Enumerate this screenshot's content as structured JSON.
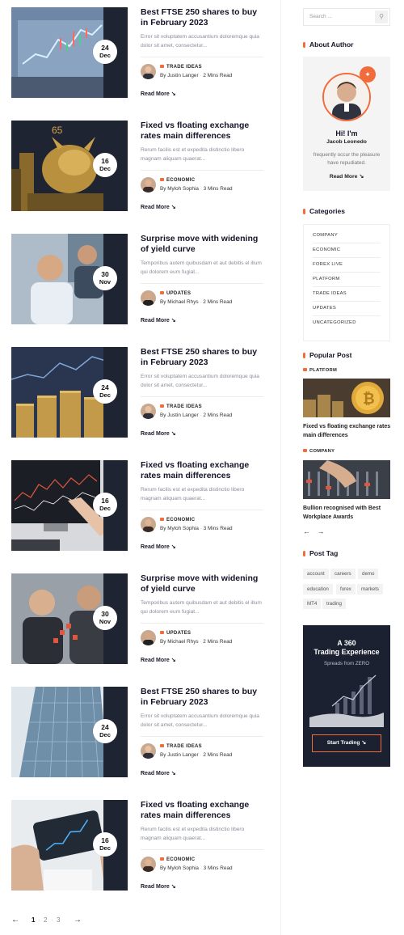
{
  "posts": [
    {
      "title": "Best FTSE 250 shares to buy in February 2023",
      "excerpt": "Error sit voluptatem accusantium doloremque quia dolor sit amet, consectetur...",
      "day": "24",
      "month": "Dec",
      "category": "TRADE IDEAS",
      "author": "By Justin Langer",
      "read_time": "2 Mins Read",
      "read_more": "Read More"
    },
    {
      "title": "Fixed vs floating exchange rates main differences",
      "excerpt": "Rerum facilis est et expedita distinctio libero magnam aliquam quaerat...",
      "day": "16",
      "month": "Dec",
      "category": "ECONOMIC",
      "author": "By Myloh Sophia",
      "read_time": "3 Mins Read",
      "read_more": "Read More"
    },
    {
      "title": "Surprise move with widening of yield curve",
      "excerpt": "Temporibus autem quibusdam et aut debitis el illum qui dolorem eum fugiat...",
      "day": "30",
      "month": "Nov",
      "category": "UPDATES",
      "author": "By Michael Rhys",
      "read_time": "2 Mins Read",
      "read_more": "Read More"
    },
    {
      "title": "Best FTSE 250 shares to buy in February 2023",
      "excerpt": "Error sit voluptatem accusantium doloremque quia dolor sit amet, consectetur...",
      "day": "24",
      "month": "Dec",
      "category": "TRADE IDEAS",
      "author": "By Justin Langer",
      "read_time": "2 Mins Read",
      "read_more": "Read More"
    },
    {
      "title": "Fixed vs floating exchange rates main differences",
      "excerpt": "Rerum facilis est et expedita distinctio libero magnam aliquam quaerat...",
      "day": "16",
      "month": "Dec",
      "category": "ECONOMIC",
      "author": "By Myloh Sophia",
      "read_time": "3 Mins Read",
      "read_more": "Read More"
    },
    {
      "title": "Surprise move with widening of yield curve",
      "excerpt": "Temporibus autem quibusdam et aut debitis el illum qui dolorem eum fugiat...",
      "day": "30",
      "month": "Nov",
      "category": "UPDATES",
      "author": "By Michael Rhys",
      "read_time": "2 Mins Read",
      "read_more": "Read More"
    },
    {
      "title": "Best FTSE 250 shares to buy in February 2023",
      "excerpt": "Error sit voluptatem accusantium doloremque quia dolor sit amet, consectetur...",
      "day": "24",
      "month": "Dec",
      "category": "TRADE IDEAS",
      "author": "By Justin Langer",
      "read_time": "2 Mins Read",
      "read_more": "Read More"
    },
    {
      "title": "Fixed vs floating exchange rates main differences",
      "excerpt": "Rerum facilis est et expedita distinctio libero magnam aliquam quaerat...",
      "day": "16",
      "month": "Dec",
      "category": "ECONOMIC",
      "author": "By Myloh Sophia",
      "read_time": "3 Mins Read",
      "read_more": "Read More"
    }
  ],
  "pagination": {
    "prev": "←",
    "pages": [
      "1",
      "2",
      "3"
    ],
    "next": "→"
  },
  "sidebar": {
    "search_placeholder": "Search ...",
    "about": {
      "title": "About Author",
      "greeting": "Hi! I'm",
      "name": "Jacob Leonedo",
      "bio": "frequently occur the pleasure have repudiated.",
      "read_more": "Read More"
    },
    "categories": {
      "title": "Categories",
      "items": [
        "COMPANY",
        "ECONOMIC",
        "FOREX LIVE",
        "PLATFORM",
        "TRADE IDEAS",
        "UPDATES",
        "UNCATEGORIZED"
      ]
    },
    "popular": {
      "title": "Popular Post",
      "items": [
        {
          "category": "PLATFORM",
          "title": "Fixed vs floating exchange rates main differences"
        },
        {
          "category": "COMPANY",
          "title": "Bullion recognised with Best Workplace Awards"
        }
      ],
      "prev": "←",
      "next": "→"
    },
    "tags": {
      "title": "Post Tag",
      "items": [
        "account",
        "careers",
        "demo",
        "education",
        "forex",
        "markets",
        "MT4",
        "trading"
      ]
    },
    "promo": {
      "line1": "A 360",
      "line2": "Trading Experience",
      "line3": "Spreads from ZERO",
      "cta": "Start Trading"
    }
  },
  "colors": {
    "accent": "#f26b3a",
    "navy": "#1c2132"
  }
}
